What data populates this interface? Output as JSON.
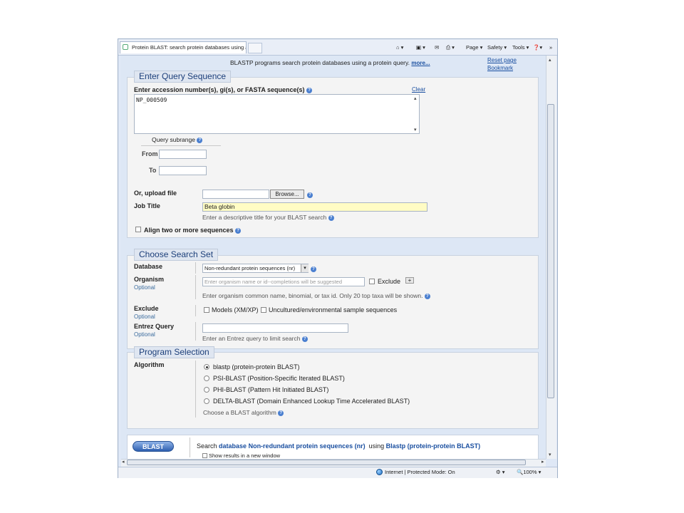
{
  "browser": {
    "tab_title": "Protein BLAST: search protein databases using a ...",
    "commands": [
      "Page ▾",
      "Safety ▾",
      "Tools ▾"
    ],
    "zoom": "100%",
    "status_zone": "Internet | Protected Mode: On"
  },
  "page": {
    "intro": "BLASTP programs search protein databases using a protein query.",
    "intro_more": "more...",
    "reset_page": "Reset page",
    "bookmark": "Bookmark"
  },
  "query": {
    "legend": "Enter Query Sequence",
    "accession_label": "Enter accession number(s), gi(s), or FASTA sequence(s)",
    "clear": "Clear",
    "sequence": "NP_000509",
    "subrange_label": "Query subrange",
    "from_label": "From",
    "to_label": "To",
    "upload_label": "Or, upload file",
    "browse": "Browse...",
    "job_title_label": "Job Title",
    "job_title_value": "Beta globin",
    "job_title_hint": "Enter a descriptive title for your BLAST search",
    "align_two": "Align two or more sequences"
  },
  "search_set": {
    "legend": "Choose Search Set",
    "database_label": "Database",
    "database_value": "Non-redundant protein sequences (nr)",
    "organism_label": "Organism",
    "optional": "Optional",
    "organism_placeholder": "Enter organism name or id--completions will be suggested",
    "exclude_checkbox": "Exclude",
    "plus": "+",
    "organism_hint": "Enter organism common name, binomial, or tax id. Only 20 top taxa will be shown.",
    "exclude_label": "Exclude",
    "exclude_models": "Models (XM/XP)",
    "exclude_uncultured": "Uncultured/environmental sample sequences",
    "entrez_label": "Entrez Query",
    "entrez_hint": "Enter an Entrez query to limit search"
  },
  "program": {
    "legend": "Program Selection",
    "algorithm_label": "Algorithm",
    "options": [
      "blastp (protein-protein BLAST)",
      "PSI-BLAST (Position-Specific Iterated BLAST)",
      "PHI-BLAST (Pattern Hit Initiated BLAST)",
      "DELTA-BLAST (Domain Enhanced Lookup Time Accelerated BLAST)"
    ],
    "selected": 0,
    "choose_hint": "Choose a BLAST algorithm"
  },
  "submit": {
    "button": "BLAST",
    "search": "Search",
    "database": "database Non-redundant protein sequences (nr)",
    "using": "using",
    "program": "Blastp (protein-protein BLAST)",
    "new_window": "Show results in a new window"
  },
  "colors": {
    "accent": "#1a4fa0",
    "highlight_input": "#fffcc4",
    "panel_bg": "#dde7f5"
  }
}
